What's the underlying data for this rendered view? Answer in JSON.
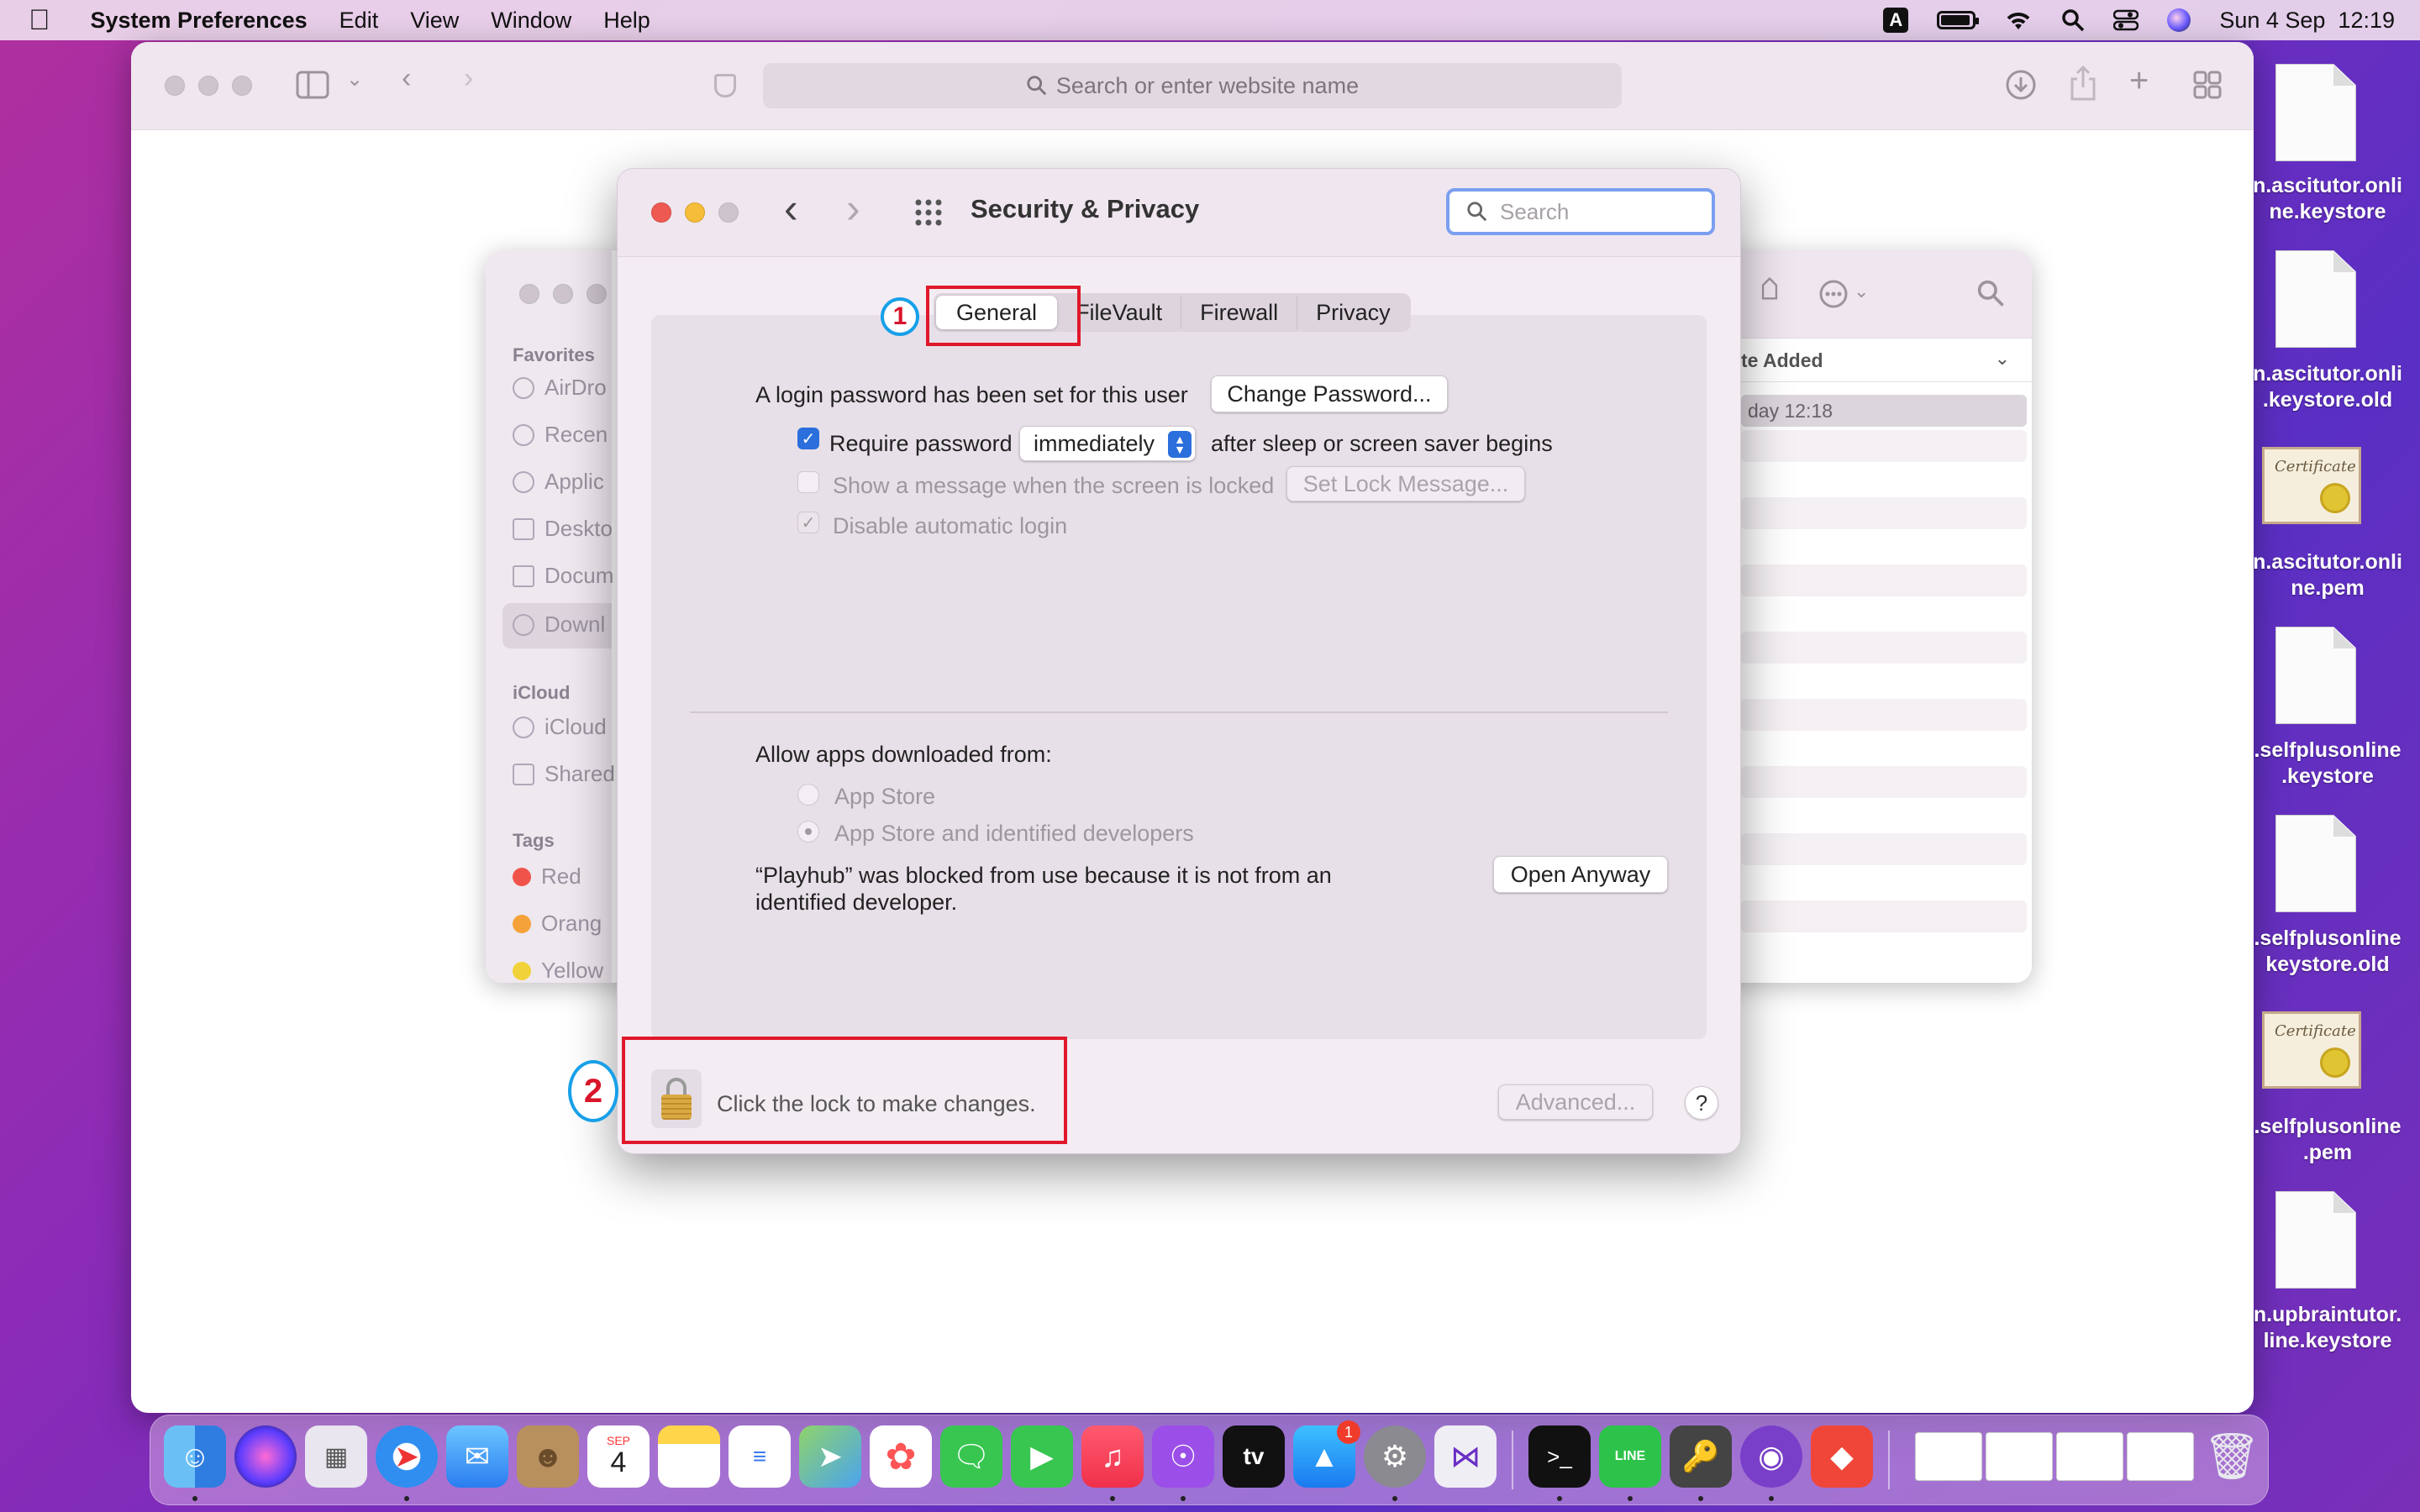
{
  "menubar": {
    "app_name": "System Preferences",
    "items": [
      "Edit",
      "View",
      "Window",
      "Help"
    ],
    "input_source": "A",
    "datetime": "Sun 4 Sep  12:19"
  },
  "browser": {
    "url_placeholder": "Search or enter website name"
  },
  "finder": {
    "favorites_header": "Favorites",
    "favorites": [
      "AirDro",
      "Recen",
      "Applic",
      "Deskto",
      "Docum",
      "Downl"
    ],
    "icloud_header": "iCloud",
    "icloud": [
      "iCloud",
      "Shared"
    ],
    "tags_header": "Tags",
    "tags": [
      {
        "label": "Red",
        "color": "#f0534a"
      },
      {
        "label": "Orang",
        "color": "#f5a23a"
      },
      {
        "label": "Yellow",
        "color": "#f2d23a"
      }
    ],
    "column_header": "te Added",
    "first_row_date": "day 12:18"
  },
  "prefs": {
    "title": "Security & Privacy",
    "search_placeholder": "Search",
    "tabs": [
      "General",
      "FileVault",
      "Firewall",
      "Privacy"
    ],
    "selected_tab": "General",
    "login_password_text": "A login password has been set for this user",
    "change_password_button": "Change Password...",
    "require_password_label": "Require password",
    "require_password_checked": true,
    "require_password_value": "immediately",
    "after_sleep_text": "after sleep or screen saver begins",
    "show_message_label": "Show a message when the screen is locked",
    "set_lock_message_button": "Set Lock Message...",
    "disable_auto_login_label": "Disable automatic login",
    "allow_apps_label": "Allow apps downloaded from:",
    "radio_app_store": "App Store",
    "radio_identified": "App Store and identified developers",
    "blocked_message_line1": "“Playhub” was blocked from use because it is not from an",
    "blocked_message_line2": "identified developer.",
    "open_anyway_button": "Open Anyway",
    "lock_text": "Click the lock to make changes.",
    "advanced_button": "Advanced...",
    "help_button": "?"
  },
  "annotations": {
    "badge1": "1",
    "badge2": "2",
    "color_box": "#e0182a",
    "color_ring": "#18a0e8"
  },
  "desktop_files": [
    {
      "line1": "n.ascitutor.onli",
      "line2": "ne.keystore",
      "kind": "file"
    },
    {
      "line1": "n.ascitutor.onli",
      "line2": ".keystore.old",
      "kind": "file"
    },
    {
      "line1": "n.ascitutor.onli",
      "line2": "ne.pem",
      "kind": "cert"
    },
    {
      "line1": ".selfplusonline",
      "line2": ".keystore",
      "kind": "file"
    },
    {
      "line1": ".selfplusonline",
      "line2": "keystore.old",
      "kind": "file"
    },
    {
      "line1": ".selfplusonline",
      "line2": ".pem",
      "kind": "cert"
    },
    {
      "line1": "n.upbraintutor.",
      "line2": "line.keystore",
      "kind": "file"
    }
  ],
  "cert_icon_text": "Certificate",
  "dock": {
    "calendar_month": "SEP",
    "calendar_day": "4",
    "appstore_badge": "1",
    "appletv_label": "tv",
    "line_label": "LINE"
  }
}
